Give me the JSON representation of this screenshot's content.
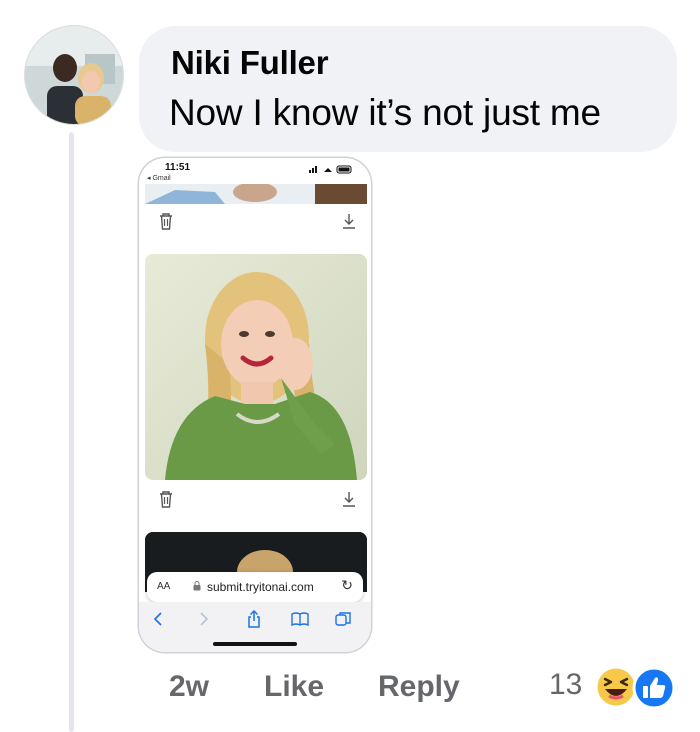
{
  "comment": {
    "author": "Niki Fuller",
    "text": "Now I know it’s not just me",
    "age": "2w",
    "like_label": "Like",
    "reply_label": "Reply",
    "reaction_count": "13",
    "reactions": [
      "haha-icon",
      "like-icon"
    ]
  },
  "phone": {
    "time": "11:51",
    "back_app": "◂ Gmail",
    "url_aa": "AA",
    "url": "submit.tryitonai.com"
  },
  "colors": {
    "bubble": "#f0f2f5",
    "meta_text": "#65676b",
    "ios_blue": "#1a73e8",
    "like_blue": "#1877f2",
    "haha_yellow": "#f7c94b"
  }
}
